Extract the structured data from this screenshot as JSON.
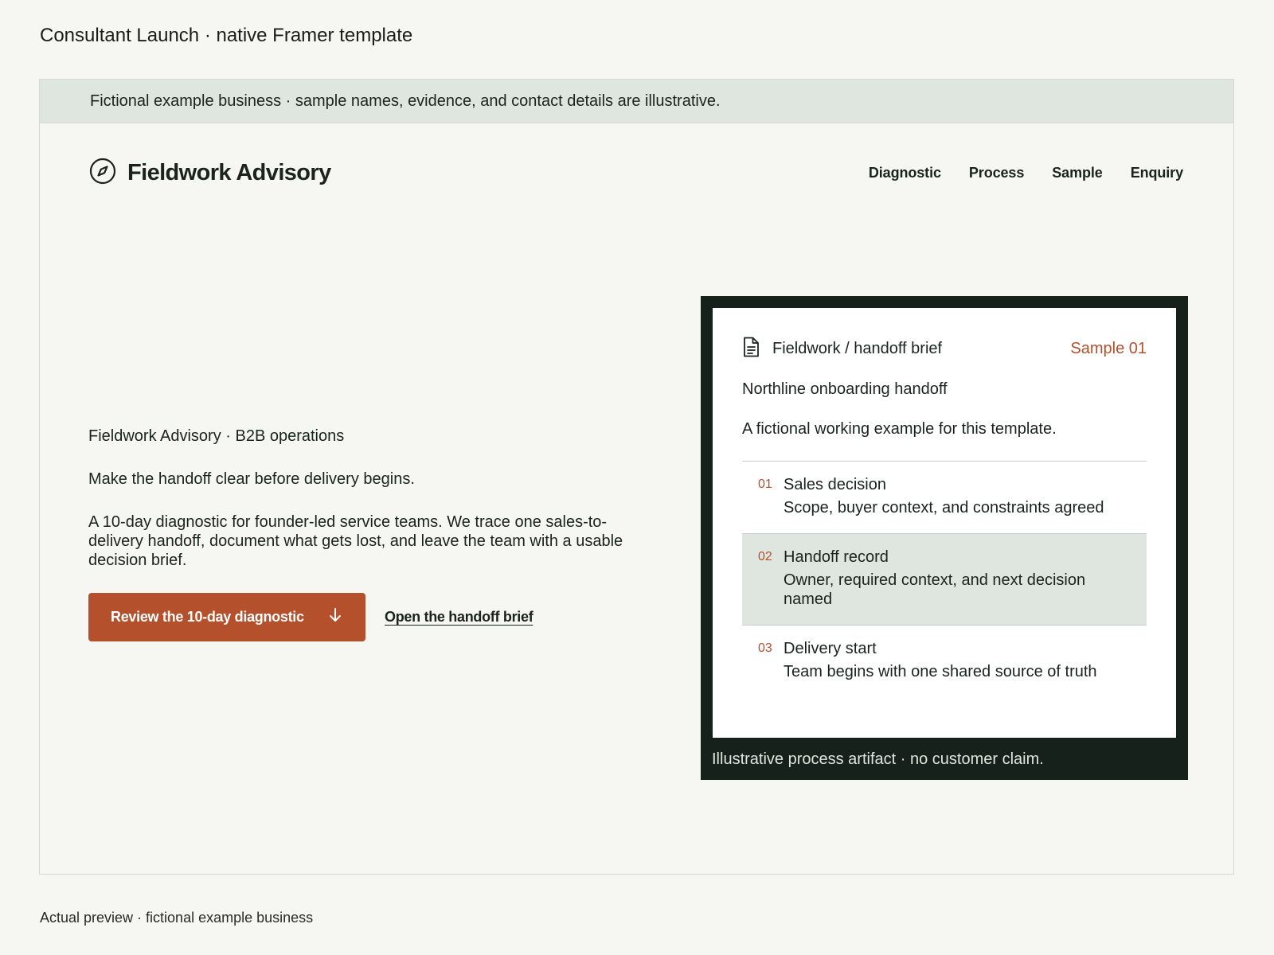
{
  "page": {
    "caption": "Consultant Launch · native Framer template",
    "footer_caption": "Actual preview · fictional example business"
  },
  "notice": {
    "text": "Fictional example business · sample names, evidence, and contact details are illustrative."
  },
  "header": {
    "brand_icon": "compass-icon",
    "brand_name": "Fieldwork Advisory",
    "nav": [
      {
        "label": "Diagnostic"
      },
      {
        "label": "Process"
      },
      {
        "label": "Sample"
      },
      {
        "label": "Enquiry"
      }
    ]
  },
  "hero": {
    "eyebrow": "Fieldwork Advisory · B2B operations",
    "headline": "Make the handoff clear before delivery begins.",
    "body": "A 10-day diagnostic for founder-led service teams. We trace one sales-to-delivery handoff, document what gets lost, and leave the team with a usable decision brief.",
    "primary_cta": "Review the 10-day diagnostic",
    "primary_cta_icon": "arrow-down-icon",
    "secondary_cta": "Open the handoff brief"
  },
  "brief": {
    "icon": "document-icon",
    "label": "Fieldwork / handoff brief",
    "sample_tag": "Sample 01",
    "title": "Northline onboarding handoff",
    "note": "A fictional working example for this template.",
    "steps": [
      {
        "num": "01",
        "title": "Sales decision",
        "desc": "Scope, buyer context, and constraints agreed"
      },
      {
        "num": "02",
        "title": "Handoff record",
        "desc": "Owner, required context, and next decision named"
      },
      {
        "num": "03",
        "title": "Delivery start",
        "desc": "Team begins with one shared source of truth"
      }
    ],
    "caption": "Illustrative process artifact · no customer claim."
  },
  "colors": {
    "accent": "#b5502d",
    "dark": "#17211c",
    "mint": "#dee6df",
    "page_bg": "#f6f6f3"
  }
}
